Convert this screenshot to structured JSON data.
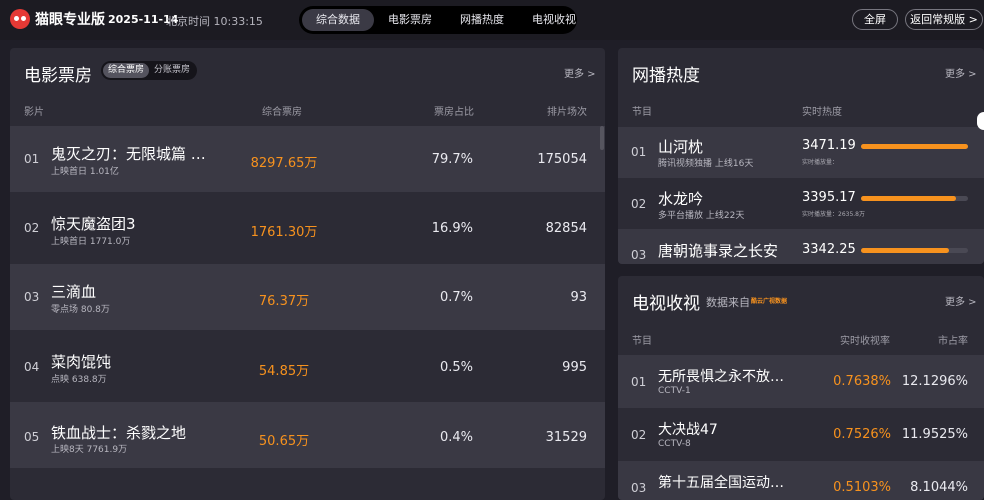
{
  "header": {
    "brand": "猫眼专业版",
    "date": "2025-11-14",
    "clock": "北京时间 10:33:15",
    "nav_tabs": [
      "综合数据",
      "电影票房",
      "网播热度",
      "电视收视"
    ],
    "active_tab": "综合数据",
    "fullscreen_label": "全屏",
    "back_label": "返回常规版 >"
  },
  "box_office": {
    "title": "电影票房",
    "toggle": [
      "综合票房",
      "分账票房"
    ],
    "more_label": "更多 >",
    "columns": [
      "影片",
      "综合票房",
      "票房占比",
      "排片场次"
    ],
    "rows": [
      {
        "rank": "01",
        "title": "鬼灭之刃：无限城篇 …",
        "sub": "上映首日  1.01亿",
        "gross": "8297.65万",
        "ratio": "79.7%",
        "shows": "175054"
      },
      {
        "rank": "02",
        "title": "惊天魔盗团3",
        "sub": "上映首日  1771.0万",
        "gross": "1761.30万",
        "ratio": "16.9%",
        "shows": "82854"
      },
      {
        "rank": "03",
        "title": "三滴血",
        "sub": "零点场  80.8万",
        "gross": "76.37万",
        "ratio": "0.7%",
        "shows": "93"
      },
      {
        "rank": "04",
        "title": "菜肉馄饨",
        "sub": "点映  638.8万",
        "gross": "54.85万",
        "ratio": "0.5%",
        "shows": "995"
      },
      {
        "rank": "05",
        "title": "铁血战士：杀戮之地",
        "sub": "上映8天  7761.9万",
        "gross": "50.65万",
        "ratio": "0.4%",
        "shows": "31529"
      }
    ]
  },
  "web_heat": {
    "title": "网播热度",
    "more_label": "更多 >",
    "columns": [
      "节目",
      "实时热度"
    ],
    "rows": [
      {
        "rank": "01",
        "title": "山河枕",
        "sub": "腾讯视频独播  上线16天",
        "value": "3471.19",
        "sub2": "实时播放量：",
        "level": 1.0
      },
      {
        "rank": "02",
        "title": "水龙吟",
        "sub": "多平台播放  上线22天",
        "value": "3395.17",
        "sub2": "实时播放量：2635.8万",
        "level": 0.89
      },
      {
        "rank": "03",
        "title": "唐朝诡事录之长安",
        "sub": "",
        "value": "3342.25",
        "sub2": "",
        "level": 0.82
      }
    ]
  },
  "tv": {
    "title": "电视收视",
    "source": "数据来自",
    "source_badge": "酷云广视数据",
    "more_label": "更多 >",
    "columns": [
      "节目",
      "实时收视率",
      "市占率"
    ],
    "rows": [
      {
        "rank": "01",
        "title": "无所畏惧之永不放…",
        "channel": "CCTV-1",
        "rate": "0.7638%",
        "share": "12.1296%"
      },
      {
        "rank": "02",
        "title": "大决战47",
        "channel": "CCTV-8",
        "rate": "0.7526%",
        "share": "11.9525%"
      },
      {
        "rank": "03",
        "title": "第十五届全国运动…",
        "channel": "",
        "rate": "0.5103%",
        "share": "8.1044%"
      }
    ]
  },
  "colors": {
    "accent": "#f7921e",
    "brand": "#e53935",
    "panel": "#2c2b35",
    "background": "#1f1e27"
  }
}
